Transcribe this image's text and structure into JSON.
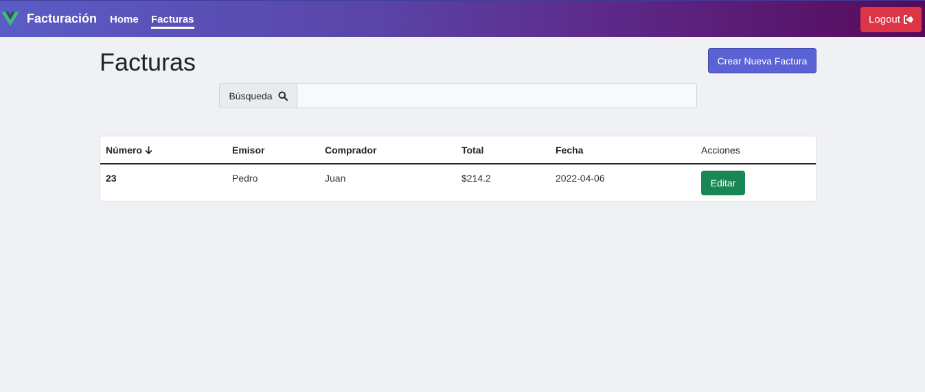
{
  "navbar": {
    "brand": "Facturación",
    "links": [
      {
        "label": "Home",
        "active": false
      },
      {
        "label": "Facturas",
        "active": true
      }
    ],
    "logout_label": "Logout"
  },
  "page": {
    "title": "Facturas",
    "create_button_label": "Crear Nueva Factura"
  },
  "search": {
    "label": "Búsqueda",
    "value": "",
    "placeholder": ""
  },
  "table": {
    "columns": [
      "Número",
      "Emisor",
      "Comprador",
      "Total",
      "Fecha",
      "Acciones"
    ],
    "sort": {
      "column": "Número",
      "direction": "desc",
      "icon": "arrow-down-icon"
    },
    "rows": [
      {
        "numero": "23",
        "emisor": "Pedro",
        "comprador": "Juan",
        "total": "$214.2",
        "fecha": "2022-04-06",
        "action_label": "Editar"
      }
    ]
  },
  "colors": {
    "logout": "#dc3545",
    "primary": "#5a63d3",
    "success": "#198754",
    "nav_gradient_start": "#5a5cc6",
    "nav_gradient_end": "#560a5a"
  }
}
